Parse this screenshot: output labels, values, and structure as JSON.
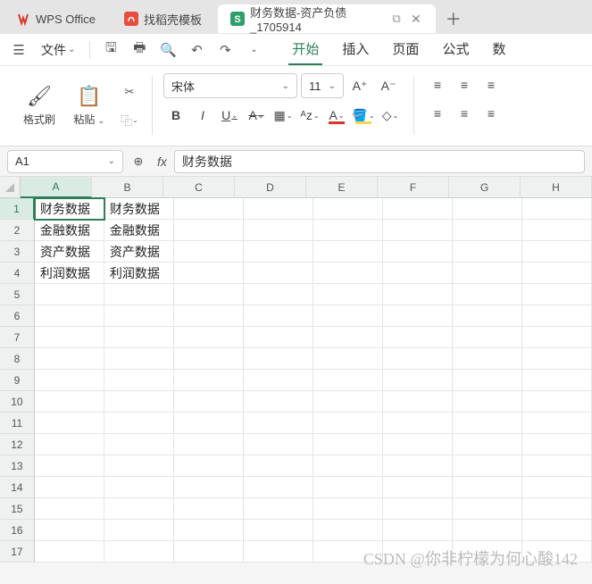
{
  "tabs": [
    {
      "label": "WPS Office",
      "icon": "wps"
    },
    {
      "label": "找稻壳模板",
      "icon": "docer"
    },
    {
      "label": "财务数据-资产负债_1705914",
      "icon": "sheet",
      "active": true,
      "closable": true
    }
  ],
  "file_menu_label": "文件",
  "menu_tabs": {
    "start": "开始",
    "insert": "插入",
    "page": "页面",
    "formula": "公式",
    "data": "数"
  },
  "ribbon": {
    "format_painter": "格式刷",
    "paste": "粘贴",
    "font_name": "宋体",
    "font_size": "11"
  },
  "name_box": "A1",
  "formula_value": "财务数据",
  "columns": [
    "A",
    "B",
    "C",
    "D",
    "E",
    "F",
    "G",
    "H"
  ],
  "selected_col": 0,
  "selected_row": 0,
  "row_count": 17,
  "cells": {
    "A1": "财务数据",
    "B1": "财务数据",
    "A2": "金融数据",
    "B2": "金融数据",
    "A3": "资产数据",
    "B3": "资产数据",
    "A4": "利润数据",
    "B4": "利润数据"
  },
  "watermark": "CSDN @你非柠檬为何心酸142"
}
